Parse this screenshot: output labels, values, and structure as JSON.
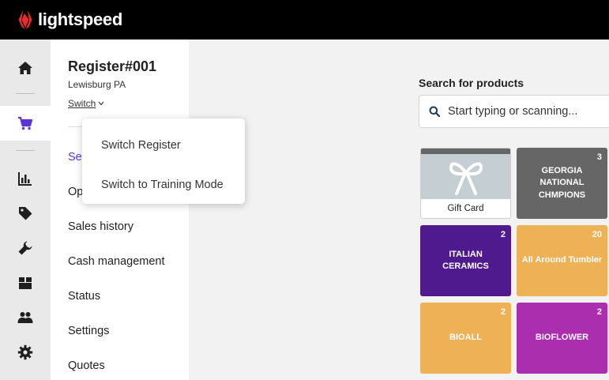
{
  "brand": {
    "name": "lightspeed",
    "accent": "#e82b2b"
  },
  "nav": {
    "items": [
      {
        "name": "home",
        "icon": "home-icon",
        "active": false
      },
      {
        "name": "sell",
        "icon": "cart-icon",
        "active": true
      },
      {
        "name": "reports",
        "icon": "bar-chart-icon",
        "active": false
      },
      {
        "name": "items",
        "icon": "tag-icon",
        "active": false
      },
      {
        "name": "service",
        "icon": "wrench-icon",
        "active": false
      },
      {
        "name": "inventory",
        "icon": "boxes-icon",
        "active": false
      },
      {
        "name": "customers",
        "icon": "users-icon",
        "active": false
      },
      {
        "name": "settings",
        "icon": "gear-icon",
        "active": false
      }
    ]
  },
  "register": {
    "title": "Register#001",
    "location": "Lewisburg PA",
    "switch_label": "Switch"
  },
  "menu": {
    "items": [
      {
        "label": "Sell",
        "active": true
      },
      {
        "label": "Open/Close"
      },
      {
        "label": "Sales history"
      },
      {
        "label": "Cash management"
      },
      {
        "label": "Status"
      },
      {
        "label": "Settings"
      },
      {
        "label": "Quotes"
      }
    ]
  },
  "dropdown": {
    "items": [
      "Switch Register",
      "Switch to Training Mode"
    ]
  },
  "search": {
    "label": "Search for products",
    "placeholder": "Start typing or scanning..."
  },
  "tiles": [
    {
      "name": "Gift Card",
      "count": "",
      "color": "#ffffff",
      "type": "gift"
    },
    {
      "name": "GEORGIA NATIONAL CHMPIONS",
      "count": "3",
      "color": "#666666"
    },
    {
      "name": "ITALIAN CERAMICS",
      "count": "2",
      "color": "#4f1a8e"
    },
    {
      "name": "All Around Tumbler",
      "count": "20",
      "color": "#efb155"
    },
    {
      "name": "BIOALL",
      "count": "2",
      "color": "#efb155"
    },
    {
      "name": "BIOFLOWER",
      "count": "2",
      "color": "#ab2eaf"
    }
  ]
}
